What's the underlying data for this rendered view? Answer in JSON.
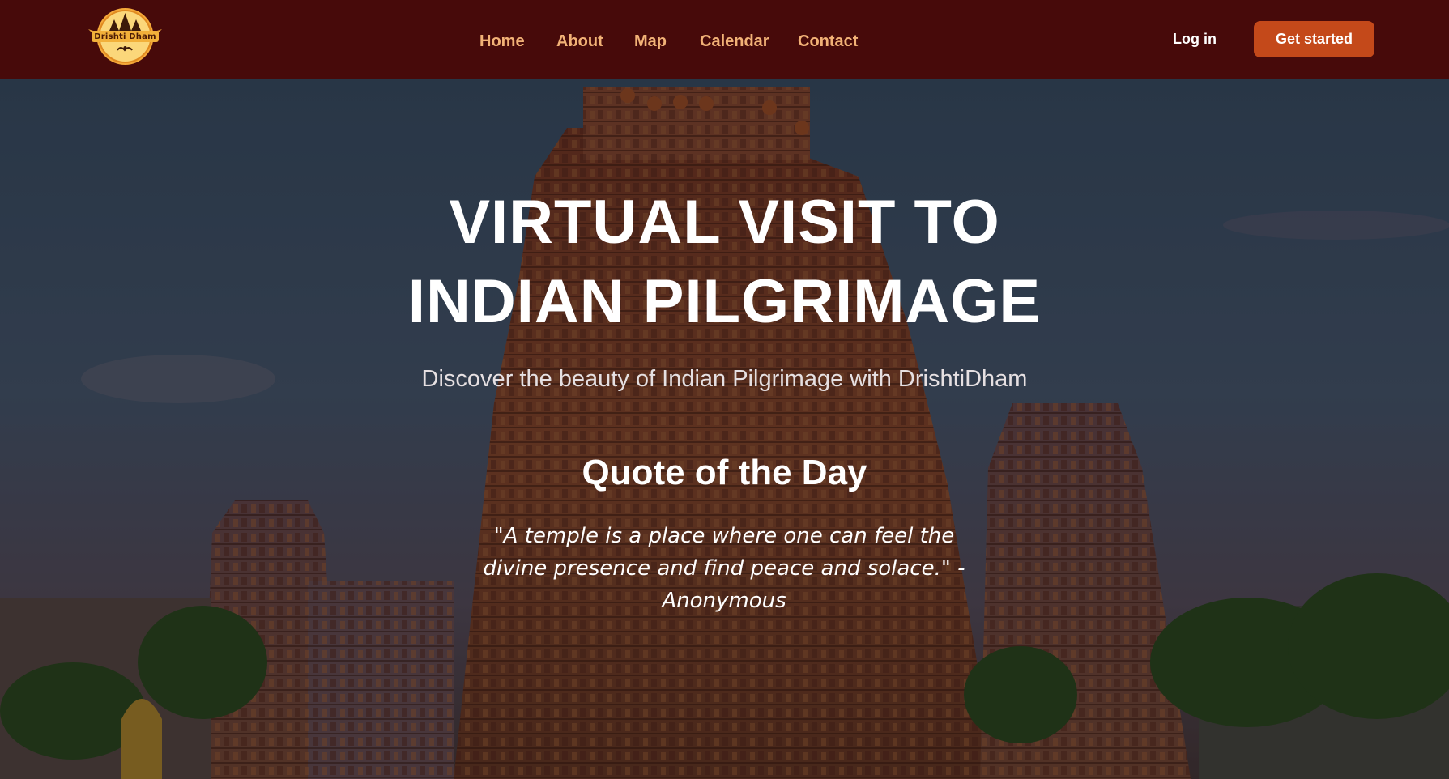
{
  "brand": {
    "logo_text": "Drishti Dham"
  },
  "nav": {
    "links": [
      "Home",
      "About",
      "Map",
      "Calendar",
      "Contact"
    ],
    "login_label": "Log in",
    "cta_label": "Get started"
  },
  "hero": {
    "headline_line1": "VIRTUAL VISIT TO",
    "headline_line2": "INDIAN PILGRIMAGE",
    "subtitle": "Discover the beauty of Indian Pilgrimage with DrishtiDham",
    "quote_title": "Quote of the Day",
    "quote_text": "\"A temple is a place where one can feel the divine presence and find peace and solace.\" - Anonymous"
  },
  "colors": {
    "navbar_bg": "#470a0a",
    "nav_link": "#f2b277",
    "cta_bg": "#c4491a"
  }
}
